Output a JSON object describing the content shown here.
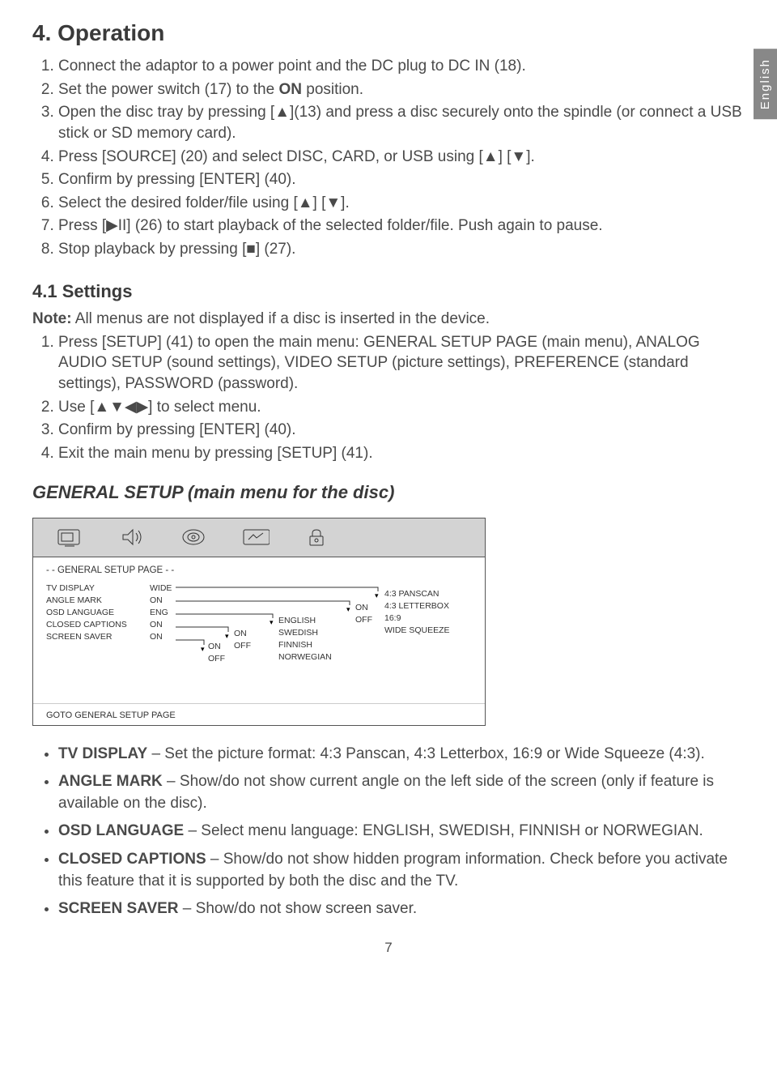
{
  "meta": {
    "pageNumber": "7",
    "languageTab": "English"
  },
  "section": {
    "title": "4. Operation"
  },
  "operationSteps": [
    "Connect the adaptor to a power point and the DC plug to DC IN (18).",
    "Set the power switch (17) to the ON position.",
    "Open the disc tray by pressing [▲](13) and press a disc securely onto the spindle (or connect a USB stick or SD memory card).",
    "Press [SOURCE] (20) and select DISC, CARD, or USB using [▲] [▼].",
    "Confirm by pressing [ENTER] (40).",
    "Select the desired folder/file using [▲] [▼].",
    "Press [▶II] (26) to start playback of the selected folder/file. Push again to pause.",
    "Stop playback by pressing [■] (27)."
  ],
  "boldWords": {
    "on": "ON",
    "note": "Note:"
  },
  "settings": {
    "title": "4.1 Settings",
    "noteText": " All menus are not displayed if a disc is inserted in the device.",
    "steps": [
      "Press [SETUP] (41) to open the main menu: GENERAL SETUP PAGE (main menu), ANALOG AUDIO SETUP (sound settings), VIDEO SETUP (picture settings), PREFERENCE (standard settings), PASSWORD (password).",
      "Use [▲▼◀▶] to select menu.",
      "Confirm by pressing [ENTER] (40).",
      "Exit the main menu by pressing [SETUP] (41)."
    ]
  },
  "generalSetupHeading": "GENERAL SETUP (main menu for the disc)",
  "diagram": {
    "header": "- -  GENERAL SETUP PAGE  - -",
    "rows": [
      {
        "label": "TV DISPLAY",
        "value": "WIDE"
      },
      {
        "label": "ANGLE MARK",
        "value": "ON"
      },
      {
        "label": "OSD LANGUAGE",
        "value": "ENG"
      },
      {
        "label": "CLOSED CAPTIONS",
        "value": "ON"
      },
      {
        "label": "SCREEN SAVER",
        "value": "ON"
      }
    ],
    "tvOptions": [
      "4:3 PANSCAN",
      "4:3 LETTERBOX",
      "16:9",
      "WIDE SQUEEZE"
    ],
    "angleOptions": [
      "ON",
      "OFF"
    ],
    "osdOptions": [
      "ENGLISH",
      "SWEDISH",
      "FINNISH",
      "NORWEGIAN"
    ],
    "ccOptions": [
      "ON",
      "OFF"
    ],
    "ssOptions": [
      "ON",
      "OFF"
    ],
    "footer": "GOTO GENERAL SETUP PAGE"
  },
  "bullets": [
    {
      "bold": "TV DISPLAY",
      "text": " – Set the picture format: 4:3 Panscan, 4:3 Letterbox, 16:9 or Wide Squeeze (4:3)."
    },
    {
      "bold": "ANGLE MARK",
      "text": " – Show/do not show current angle on the left side of the screen (only if feature is available on the disc)."
    },
    {
      "bold": "OSD LANGUAGE",
      "text": " – Select menu language: ENGLISH, SWEDISH, FINNISH or NORWEGIAN."
    },
    {
      "bold": "CLOSED CAPTIONS",
      "text": " – Show/do not show hidden program information. Check before you activate this feature that it is supported by both the disc and the TV."
    },
    {
      "bold": "SCREEN SAVER",
      "text": " – Show/do not show screen saver."
    }
  ]
}
